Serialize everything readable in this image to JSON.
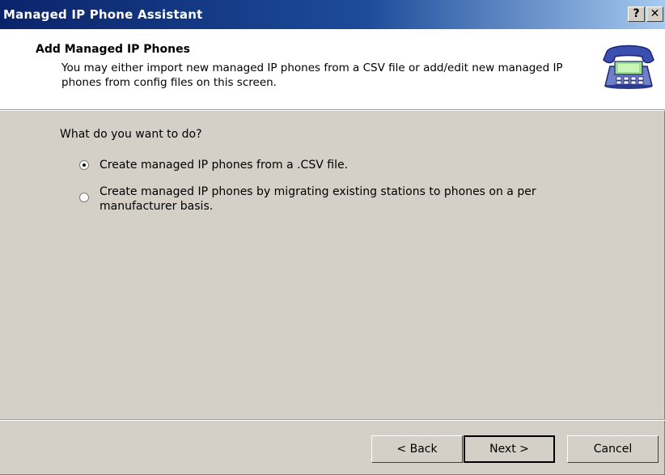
{
  "window": {
    "title": "Managed IP Phone Assistant",
    "help_label": "?",
    "close_label": "✕"
  },
  "header": {
    "title": "Add Managed IP Phones",
    "description": "You may either import new managed IP phones from a CSV file or add/edit new managed IP phones from config files on this screen.",
    "icon": "telephone-icon"
  },
  "main": {
    "question": "What do you want to do?",
    "options": [
      {
        "label": "Create managed IP phones from a .CSV file.",
        "selected": true
      },
      {
        "label_line1": "Create managed IP phones by migrating existing stations to phones on a per",
        "label_line2": "manufacturer basis.",
        "selected": false
      }
    ]
  },
  "footer": {
    "back_label": "< Back",
    "next_label": "Next >",
    "cancel_label": "Cancel"
  }
}
